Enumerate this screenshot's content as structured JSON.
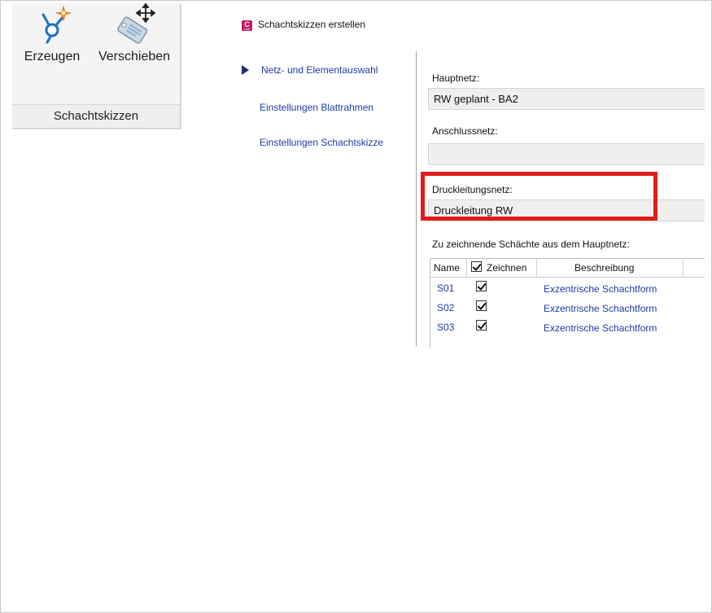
{
  "ribbon": {
    "buttons": [
      {
        "label": "Erzeugen",
        "icon": "create-sketch-icon"
      },
      {
        "label": "Verschieben",
        "icon": "move-tag-icon"
      }
    ],
    "group_label": "Schachtskizzen"
  },
  "dialog": {
    "title": "Schachtskizzen erstellen",
    "nav": [
      {
        "label": "Netz- und Elementauswahl",
        "active": true
      },
      {
        "label": "Einstellungen Blattrahmen",
        "active": false
      },
      {
        "label": "Einstellungen Schachtskizze",
        "active": false
      }
    ],
    "hauptnetz": {
      "label": "Hauptnetz:",
      "value": "RW geplant - BA2"
    },
    "anschlussnetz": {
      "label": "Anschlussnetz:",
      "value": ""
    },
    "druckleitungsnetz": {
      "label": "Druckleitungsnetz:",
      "value": "Druckleitung RW"
    },
    "table": {
      "caption": "Zu zeichnende Schächte aus dem Hauptnetz:",
      "headers": {
        "name": "Name",
        "draw": "Zeichnen",
        "description": "Beschreibung"
      },
      "header_checked": true,
      "rows": [
        {
          "name": "S01",
          "draw": true,
          "description": "Exzentrische Schachtform"
        },
        {
          "name": "S02",
          "draw": true,
          "description": "Exzentrische Schachtform"
        },
        {
          "name": "S03",
          "draw": true,
          "description": "Exzentrische Schachtform"
        }
      ]
    }
  },
  "colors": {
    "highlight": "#e21c1c",
    "link": "#1e3aa8",
    "icon_accent": "#1f6fc4",
    "icon_spark": "#f2a20c"
  }
}
